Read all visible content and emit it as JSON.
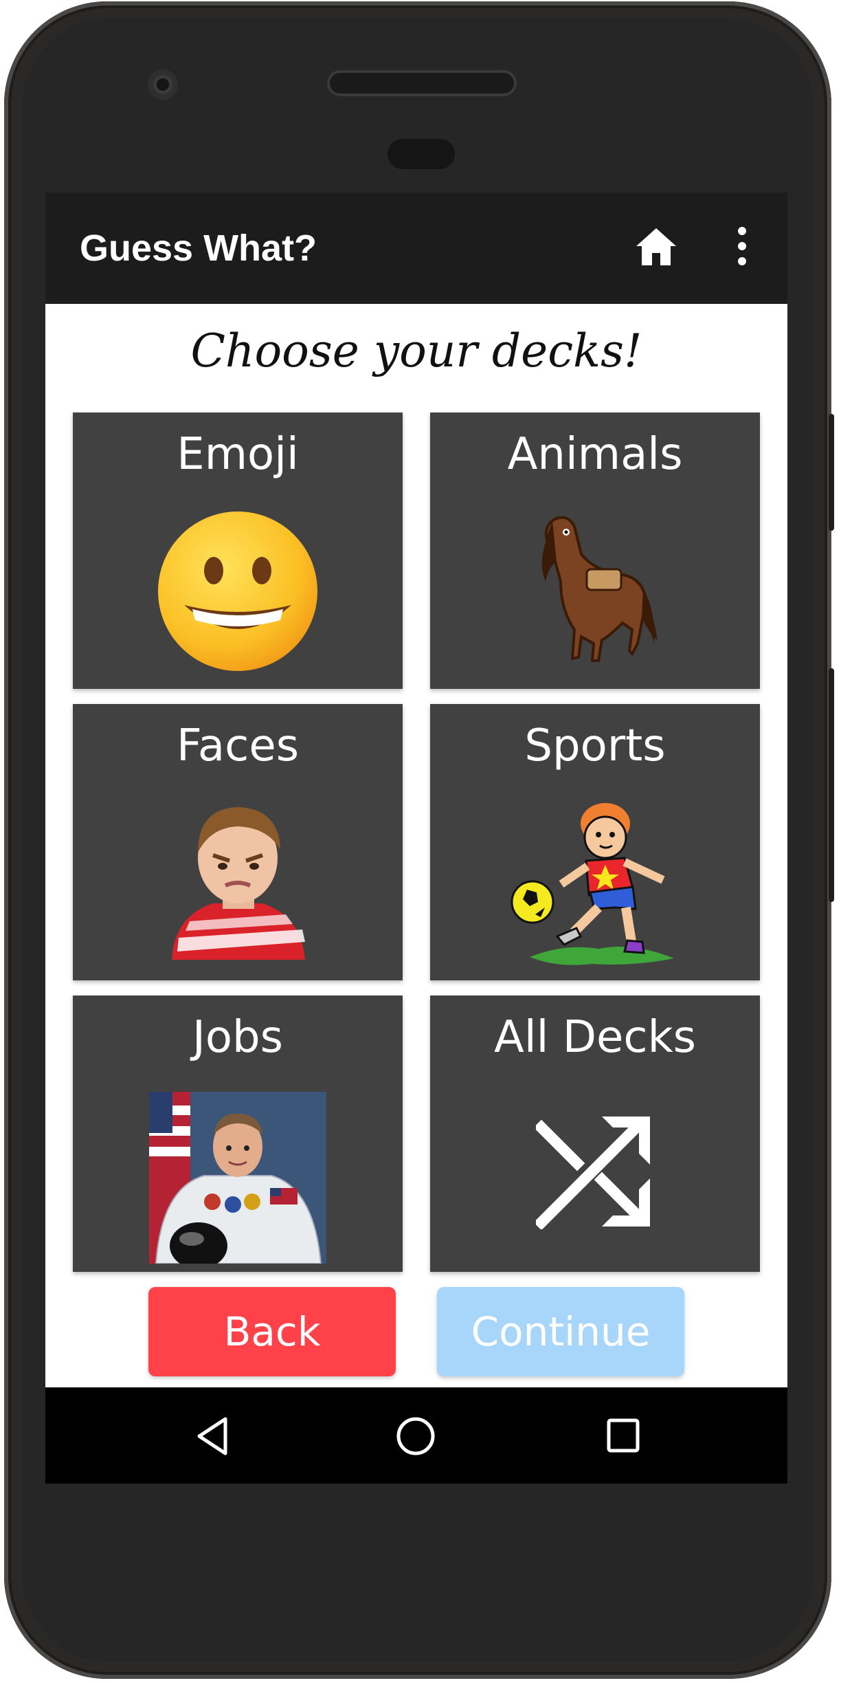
{
  "app": {
    "title": "Guess What?"
  },
  "heading": "Choose your decks!",
  "decks": [
    {
      "label": "Emoji",
      "icon": "grinning-emoji-icon"
    },
    {
      "label": "Animals",
      "icon": "horse-icon"
    },
    {
      "label": "Faces",
      "icon": "frowning-child-photo"
    },
    {
      "label": "Sports",
      "icon": "soccer-player-icon"
    },
    {
      "label": "Jobs",
      "icon": "astronaut-photo"
    },
    {
      "label": "All Decks",
      "icon": "shuffle-icon"
    }
  ],
  "buttons": {
    "back": "Back",
    "continue": "Continue"
  },
  "colors": {
    "appbar": "#1c1c1c",
    "card": "#414141",
    "back": "#ff4249",
    "continue": "#a8d6fb"
  }
}
